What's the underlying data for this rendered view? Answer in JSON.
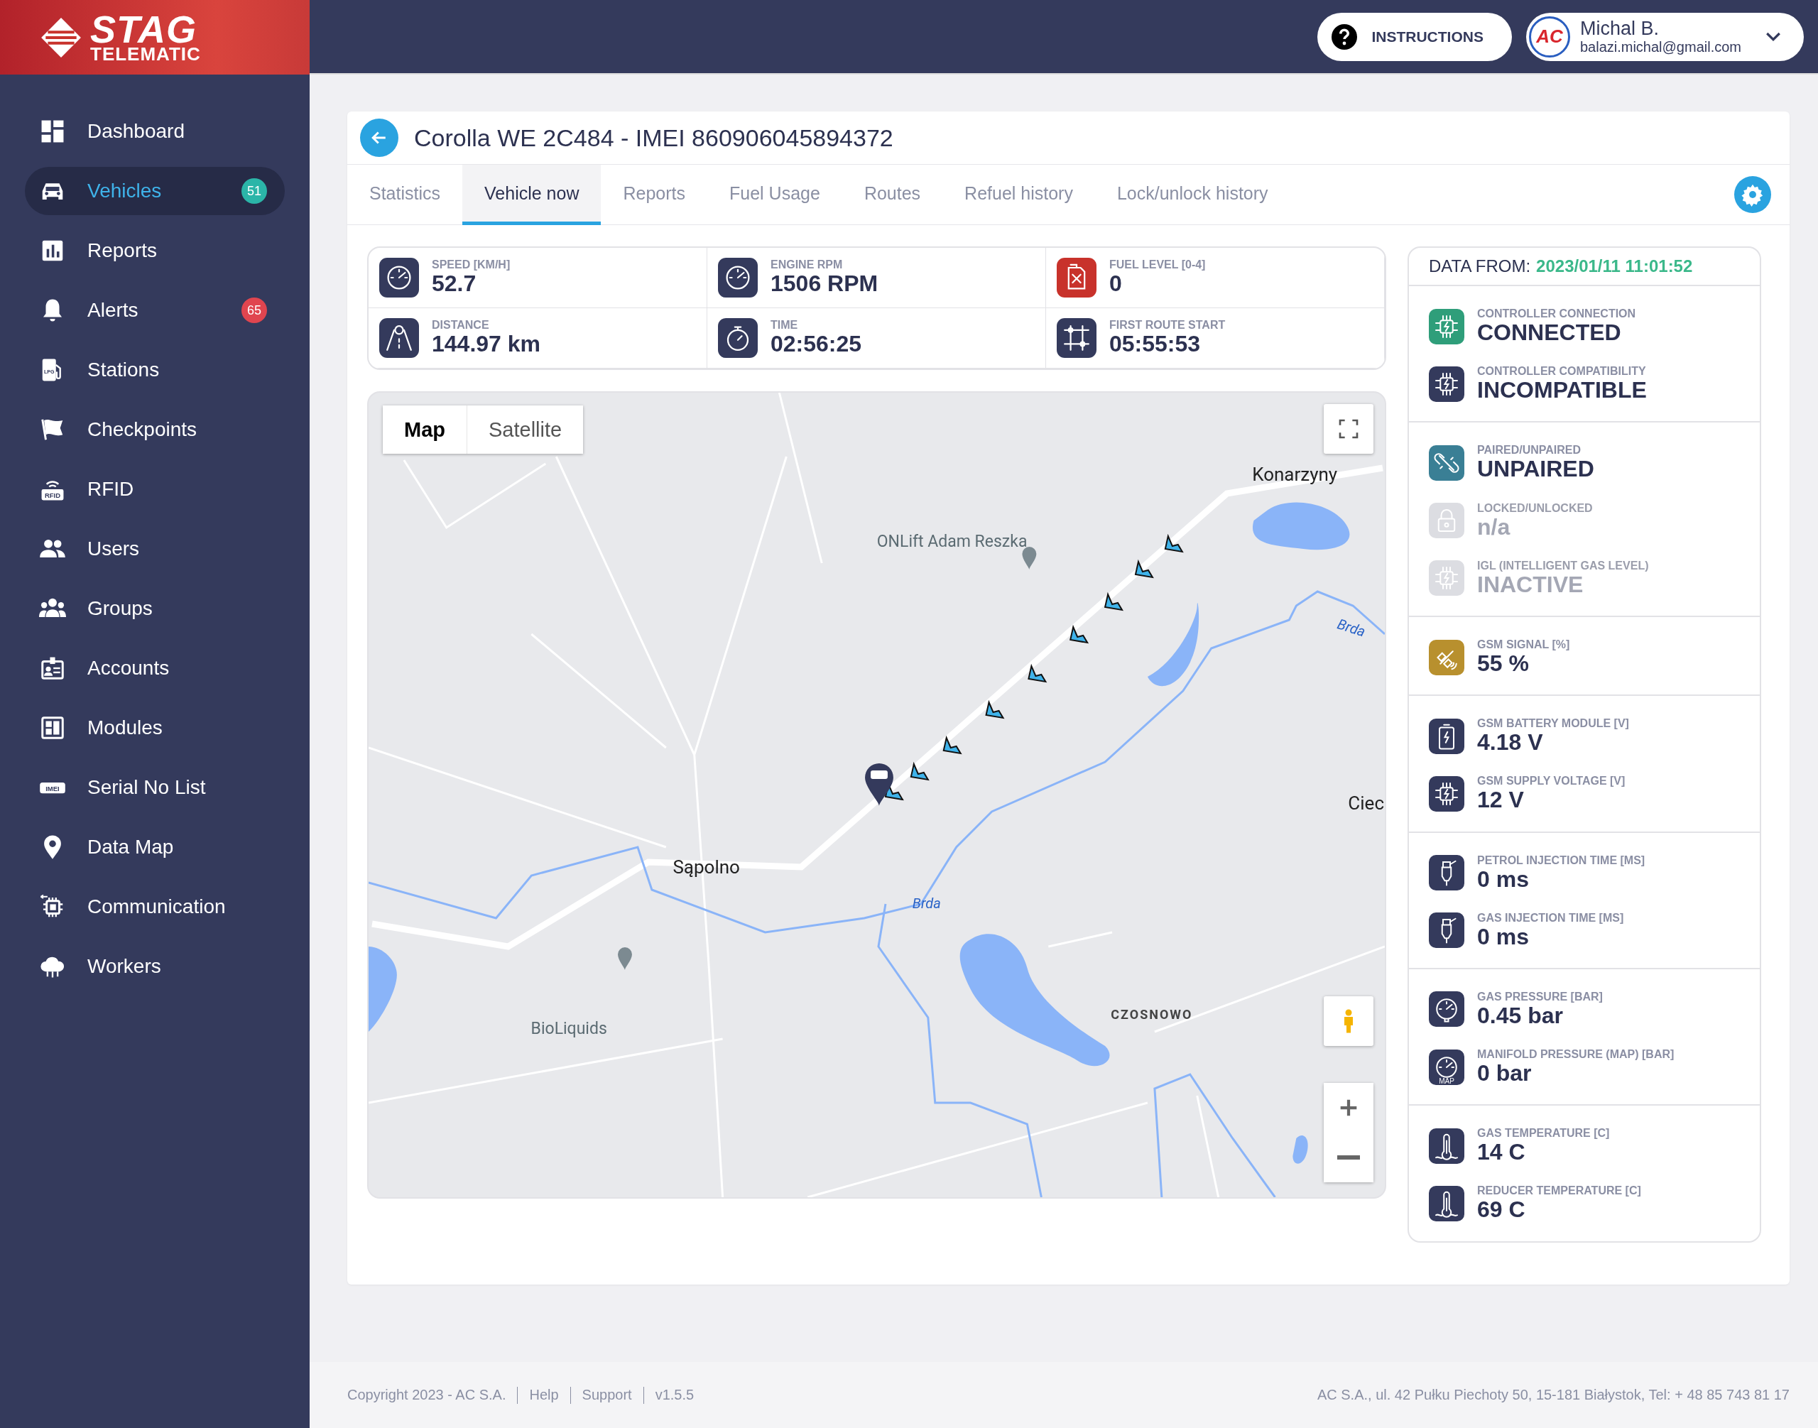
{
  "logo": {
    "line_1": "STAG",
    "line_2": "TELEMATIC"
  },
  "header": {
    "instructions_button": "INSTRUCTIONS",
    "user": {
      "avatar_text": "AC",
      "name": "Michal B.",
      "email": "balazi.michal@gmail.com"
    }
  },
  "sidebar": {
    "items": [
      {
        "label": "Dashboard",
        "kind": "dashboard",
        "selected": false
      },
      {
        "label": "Vehicles",
        "kind": "car",
        "selected": true,
        "badge": {
          "text": "51",
          "color": "#2bb5a8"
        }
      },
      {
        "label": "Reports",
        "kind": "chart",
        "selected": false
      },
      {
        "label": "Alerts",
        "kind": "bell",
        "selected": false,
        "badge": {
          "text": "65",
          "color": "#e0454f"
        }
      },
      {
        "label": "Stations",
        "kind": "pump",
        "icon_text": "LPG",
        "selected": false
      },
      {
        "label": "Checkpoints",
        "kind": "flag",
        "selected": false
      },
      {
        "label": "RFID",
        "kind": "rfid",
        "icon_text": "RFID",
        "selected": false
      },
      {
        "label": "Users",
        "kind": "users",
        "selected": false
      },
      {
        "label": "Groups",
        "kind": "groups",
        "selected": false
      },
      {
        "label": "Accounts",
        "kind": "badge",
        "selected": false
      },
      {
        "label": "Modules",
        "kind": "module",
        "selected": false
      },
      {
        "label": "Serial No List",
        "kind": "imei",
        "icon_text": "IMEI",
        "selected": false
      },
      {
        "label": "Data Map",
        "kind": "pin",
        "selected": false
      },
      {
        "label": "Communication",
        "kind": "chip",
        "selected": false
      },
      {
        "label": "Workers",
        "kind": "cloud",
        "selected": false
      }
    ]
  },
  "vehicle": {
    "title": "Corolla WE 2C484 - IMEI 860906045894372",
    "tabs": [
      {
        "label": "Statistics",
        "selected": false
      },
      {
        "label": "Vehicle now",
        "selected": true
      },
      {
        "label": "Reports",
        "selected": false
      },
      {
        "label": "Fuel Usage",
        "selected": false
      },
      {
        "label": "Routes",
        "selected": false
      },
      {
        "label": "Refuel history",
        "selected": false
      },
      {
        "label": "Lock/unlock history",
        "selected": false
      }
    ],
    "stats": [
      {
        "label": "SPEED [KM/H]",
        "value": "52.7",
        "kind": "speedometer",
        "color": "#343a5c"
      },
      {
        "label": "ENGINE RPM",
        "value": "1506 RPM",
        "kind": "gauge",
        "color": "#343a5c"
      },
      {
        "label": "FUEL LEVEL [0-4]",
        "value": "0",
        "kind": "fuel",
        "color": "#c8322b"
      },
      {
        "label": "DISTANCE",
        "value": "144.97 km",
        "kind": "road",
        "color": "#343a5c"
      },
      {
        "label": "TIME",
        "value": "02:56:25",
        "kind": "stopwatch",
        "color": "#343a5c"
      },
      {
        "label": "FIRST ROUTE START",
        "value": "05:55:53",
        "kind": "route",
        "color": "#343a5c"
      }
    ]
  },
  "map": {
    "map_types": [
      {
        "label": "Map",
        "selected": true
      },
      {
        "label": "Satellite",
        "selected": false
      }
    ],
    "labels": [
      {
        "text": "Konarzyny",
        "kind": "town"
      },
      {
        "text": "ONLift Adam Reszka",
        "kind": "poi"
      },
      {
        "text": "Sąpolno",
        "kind": "town"
      },
      {
        "text": "Brda",
        "kind": "river"
      },
      {
        "text": "Brda",
        "kind": "river"
      },
      {
        "text": "Ciec",
        "kind": "town"
      },
      {
        "text": "CZOSNOWO",
        "kind": "district"
      },
      {
        "text": "BioLiquids",
        "kind": "poi"
      }
    ]
  },
  "status_panel": {
    "data_from_label": "DATA FROM:",
    "data_from_value": "2023/01/11 11:01:52",
    "groups": [
      [
        {
          "label": "CONTROLLER CONNECTION",
          "value": "CONNECTED",
          "kind": "chip",
          "color": "#2f9e7a",
          "disabled": false
        },
        {
          "label": "CONTROLLER COMPATIBILITY",
          "value": "INCOMPATIBLE",
          "kind": "chip",
          "color": "#343a5c",
          "disabled": false
        }
      ],
      [
        {
          "label": "PAIRED/UNPAIRED",
          "value": "UNPAIRED",
          "kind": "unlink",
          "color": "#3a7f95",
          "disabled": false
        },
        {
          "label": "LOCKED/UNLOCKED",
          "value": "n/a",
          "kind": "lock",
          "disabled": true
        },
        {
          "label": "IGL (INTELLIGENT GAS LEVEL)",
          "value": "INACTIVE",
          "kind": "chip",
          "disabled": true
        }
      ],
      [
        {
          "label": "GSM SIGNAL [%]",
          "value": "55 %",
          "kind": "satellite",
          "color": "#b8902e",
          "disabled": false
        }
      ],
      [
        {
          "label": "GSM BATTERY MODULE [V]",
          "value": "4.18 V",
          "kind": "battery",
          "color": "#343a5c",
          "disabled": false
        },
        {
          "label": "GSM SUPPLY VOLTAGE [V]",
          "value": "12 V",
          "kind": "chip",
          "color": "#343a5c",
          "disabled": false
        }
      ],
      [
        {
          "label": "PETROL INJECTION TIME [MS]",
          "value": "0 ms",
          "kind": "injector",
          "color": "#343a5c",
          "disabled": false
        },
        {
          "label": "GAS INJECTION TIME [MS]",
          "value": "0 ms",
          "kind": "injector",
          "color": "#343a5c",
          "disabled": false
        }
      ],
      [
        {
          "label": "GAS PRESSURE [BAR]",
          "value": "0.45 bar",
          "kind": "manometer",
          "color": "#343a5c",
          "disabled": false
        },
        {
          "label": "MANIFOLD PRESSURE (MAP) [BAR]",
          "value": "0 bar",
          "kind": "map-gauge",
          "icon_text": "MAP",
          "color": "#343a5c",
          "disabled": false
        }
      ],
      [
        {
          "label": "GAS TEMPERATURE [C]",
          "value": "14 C",
          "kind": "thermometer",
          "color": "#343a5c",
          "disabled": false
        },
        {
          "label": "REDUCER TEMPERATURE [C]",
          "value": "69 C",
          "kind": "thermometer",
          "color": "#343a5c",
          "disabled": false
        }
      ]
    ]
  },
  "footer": {
    "links": [
      "Copyright 2023 - AC S.A.",
      "Help",
      "Support",
      "v1.5.5"
    ],
    "address": "AC S.A., ul. 42 Pułku Piechoty 50, 15-181 Białystok, Tel: + 48 85 743 81 17"
  }
}
